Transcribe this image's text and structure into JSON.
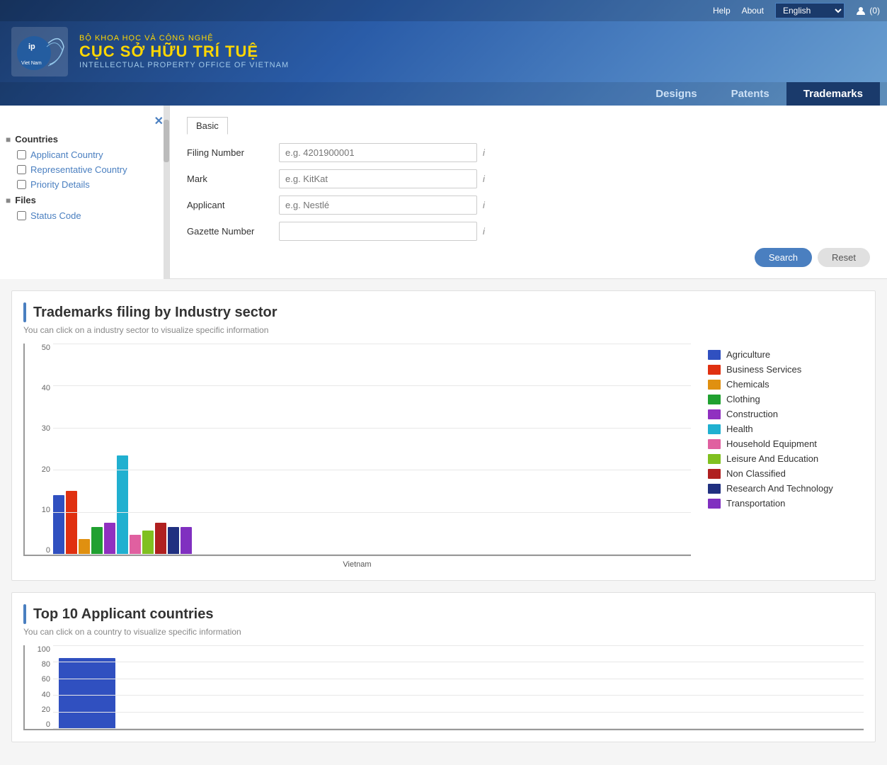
{
  "header": {
    "ministry": "BỘ KHOA HỌC VÀ CÔNG NGHỆ",
    "org_name": "CỤC SỞ HỮU TRÍ TUỆ",
    "sub_name": "INTELLECTUAL PROPERTY OFFICE OF VIETNAM",
    "help_label": "Help",
    "about_label": "About",
    "language": "English",
    "user_badge": "(0)",
    "nav": [
      {
        "label": "Designs",
        "active": false
      },
      {
        "label": "Patents",
        "active": false
      },
      {
        "label": "Trademarks",
        "active": true
      }
    ]
  },
  "sidebar": {
    "close_icon": "✕",
    "sections": [
      {
        "label": "Countries",
        "expanded": true,
        "items": [
          {
            "label": "Applicant Country",
            "checked": false
          },
          {
            "label": "Representative Country",
            "checked": false
          },
          {
            "label": "Priority Details",
            "checked": false
          }
        ]
      },
      {
        "label": "Files",
        "expanded": true,
        "items": [
          {
            "label": "Status Code",
            "checked": false
          }
        ]
      }
    ]
  },
  "search_form": {
    "tab": "Basic",
    "fields": [
      {
        "label": "Filing Number",
        "placeholder": "e.g. 4201900001",
        "value": "",
        "info": true
      },
      {
        "label": "Mark",
        "placeholder": "e.g. KitKat",
        "value": "",
        "info": true
      },
      {
        "label": "Applicant",
        "placeholder": "e.g. Nestlé",
        "value": "",
        "info": true
      },
      {
        "label": "Gazette Number",
        "placeholder": "",
        "value": "",
        "info": true
      }
    ],
    "search_button": "Search",
    "reset_button": "Reset"
  },
  "industry_chart": {
    "title": "Trademarks filing by Industry sector",
    "subtitle": "You can click on a industry sector to visualize specific information",
    "y_labels": [
      "0",
      "10",
      "20",
      "30",
      "40",
      "50"
    ],
    "x_label": "Vietnam",
    "categories": [
      {
        "label": "Agriculture",
        "color": "#3050c0",
        "value": 15
      },
      {
        "label": "Business Services",
        "color": "#e03010",
        "value": 16
      },
      {
        "label": "Chemicals",
        "color": "#e09010",
        "value": 4
      },
      {
        "label": "Clothing",
        "color": "#20a030",
        "value": 7
      },
      {
        "label": "Construction",
        "color": "#9030c0",
        "value": 8
      },
      {
        "label": "Health",
        "color": "#20b0d0",
        "value": 25
      },
      {
        "label": "Household Equipment",
        "color": "#e060a0",
        "value": 5
      },
      {
        "label": "Leisure And Education",
        "color": "#80c020",
        "value": 6
      },
      {
        "label": "Non Classified",
        "color": "#b02020",
        "value": 8
      },
      {
        "label": "Research And Technology",
        "color": "#203080",
        "value": 7
      },
      {
        "label": "Transportation",
        "color": "#8030c0",
        "value": 7
      }
    ]
  },
  "applicant_chart": {
    "title": "Top 10 Applicant countries",
    "subtitle": "You can click on a country to visualize specific information",
    "y_labels": [
      "0",
      "20",
      "40",
      "60",
      "80",
      "100"
    ],
    "bar_color": "#3050c0",
    "partial_value": 85
  }
}
